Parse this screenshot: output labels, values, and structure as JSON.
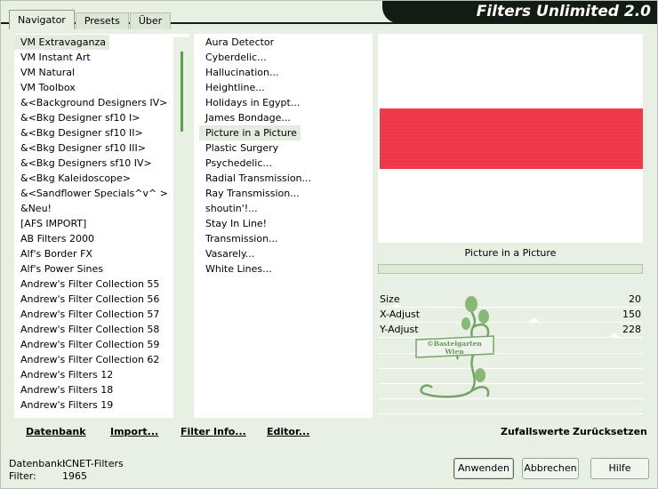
{
  "window": {
    "title": "Filters Unlimited 2.0"
  },
  "tabs": [
    {
      "label": "Navigator",
      "active": true
    },
    {
      "label": "Presets",
      "active": false
    },
    {
      "label": "Über",
      "active": false
    }
  ],
  "categories": {
    "selected": "VM Extravaganza",
    "items": [
      "VM Extravaganza",
      "VM Instant Art",
      "VM Natural",
      "VM Toolbox",
      "&<Background Designers IV>",
      "&<Bkg Designer sf10 I>",
      "&<Bkg Designer sf10 II>",
      "&<Bkg Designer sf10 III>",
      "&<Bkg Designers sf10 IV>",
      "&<Bkg Kaleidoscope>",
      "&<Sandflower Specials^v^ >",
      "&Neu!",
      "[AFS IMPORT]",
      "AB Filters 2000",
      "Alf's Border FX",
      "Alf's Power Sines",
      "Andrew's Filter Collection 55",
      "Andrew's Filter Collection 56",
      "Andrew's Filter Collection 57",
      "Andrew's Filter Collection 58",
      "Andrew's Filter Collection 59",
      "Andrew's Filter Collection 62",
      "Andrew's Filters 12",
      "Andrew's Filters 18",
      "Andrew's Filters 19"
    ]
  },
  "filters": {
    "selected": "Picture in a Picture",
    "items": [
      "Aura Detector",
      "Cyberdelic...",
      "Hallucination...",
      "Heightline...",
      "Holidays in Egypt...",
      "James Bondage...",
      "Picture in a Picture",
      "Plastic Surgery",
      "Psychedelic...",
      "Radial Transmission...",
      "Ray Transmission...",
      "shoutin'!...",
      "Stay In Line!",
      "Transmission...",
      "Vasarely...",
      "White Lines..."
    ]
  },
  "preview": {
    "filter_name": "Picture in a Picture",
    "stripe_color": "#f23a4a"
  },
  "params": [
    {
      "label": "Size",
      "value": "20",
      "level": 20
    },
    {
      "label": "X-Adjust",
      "value": "150",
      "level": 150
    },
    {
      "label": "Y-Adjust",
      "value": "228",
      "level": 228
    }
  ],
  "watermark": {
    "line1": "©Bastelgarten",
    "line2": "Wien"
  },
  "bottom_links": {
    "datenbank": "Datenbank",
    "import": "Import...",
    "filter_info": "Filter Info...",
    "editor": "Editor...",
    "zufallswerte": "Zufallswerte",
    "zuruecksetzen": "Zurücksetzen"
  },
  "status": {
    "datenbank_label": "Datenbank:",
    "datenbank_value": "ICNET-Filters",
    "filter_label": "Filter:",
    "filter_value": "1965"
  },
  "buttons": {
    "anwenden": "Anwenden",
    "abbrechen": "Abbrechen",
    "hilfe": "Hilfe"
  }
}
